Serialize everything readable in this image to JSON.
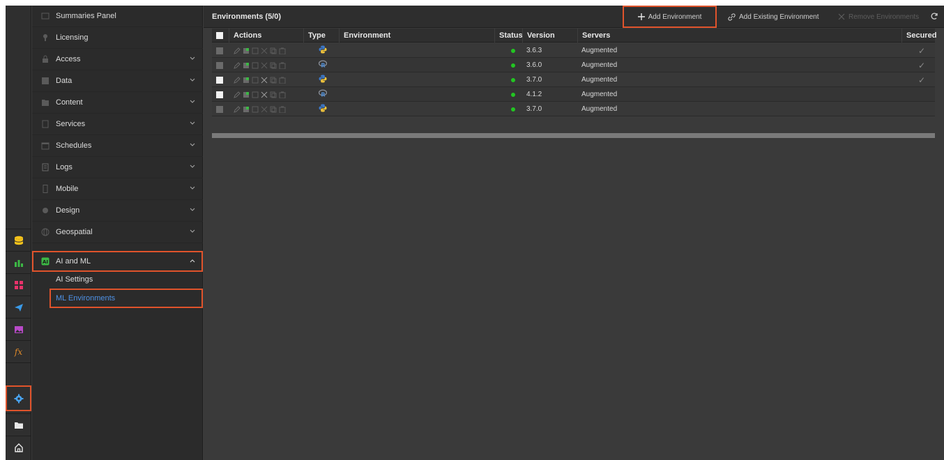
{
  "rail": {
    "icons": [
      "database-icon",
      "bar-chart-icon",
      "dashboard-grid-icon",
      "send-icon",
      "image-icon",
      "function-icon",
      "gear-icon",
      "folder-icon",
      "home-icon"
    ]
  },
  "nav": {
    "items": [
      {
        "label": "Summaries Panel",
        "icon": "summaries-icon",
        "expandable": false
      },
      {
        "label": "Licensing",
        "icon": "license-icon",
        "expandable": false
      },
      {
        "label": "Access",
        "icon": "lock-icon",
        "expandable": true
      },
      {
        "label": "Data",
        "icon": "database-icon",
        "expandable": true
      },
      {
        "label": "Content",
        "icon": "folder-icon",
        "expandable": true
      },
      {
        "label": "Services",
        "icon": "services-icon",
        "expandable": true
      },
      {
        "label": "Schedules",
        "icon": "calendar-icon",
        "expandable": true
      },
      {
        "label": "Logs",
        "icon": "log-icon",
        "expandable": true
      },
      {
        "label": "Mobile",
        "icon": "mobile-icon",
        "expandable": true
      },
      {
        "label": "Design",
        "icon": "design-icon",
        "expandable": true
      },
      {
        "label": "Geospatial",
        "icon": "globe-icon",
        "expandable": true
      },
      {
        "label": "AI and ML",
        "icon": "ai-icon",
        "expandable": true
      }
    ],
    "sub_items": [
      {
        "label": "AI Settings"
      },
      {
        "label": "ML Environments"
      }
    ]
  },
  "toolbar": {
    "title": "Environments (5/0)",
    "add_env": "Add Environment",
    "add_existing": "Add Existing Environment",
    "remove": "Remove Environments"
  },
  "table": {
    "headers": {
      "actions": "Actions",
      "type": "Type",
      "environment": "Environment",
      "status": "Status",
      "version": "Version",
      "servers": "Servers",
      "secured": "Secured"
    },
    "rows": [
      {
        "type": "python",
        "version": "3.6.3",
        "server": "Augmented",
        "secured": true,
        "checkbox": "gray"
      },
      {
        "type": "r",
        "version": "3.6.0",
        "server": "Augmented",
        "secured": true,
        "checkbox": "gray"
      },
      {
        "type": "python",
        "version": "3.7.0",
        "server": "Augmented",
        "secured": true,
        "checkbox": "white"
      },
      {
        "type": "r",
        "version": "4.1.2",
        "server": "Augmented",
        "secured": false,
        "checkbox": "white"
      },
      {
        "type": "python",
        "version": "3.7.0",
        "server": "Augmented",
        "secured": false,
        "checkbox": "gray"
      }
    ]
  },
  "colors": {
    "highlight": "#e0532b",
    "selected_link": "#4f92e6",
    "status_ok": "#22c522",
    "python_blue": "#3c78c8",
    "python_yellow": "#f0c43c",
    "r_blue": "#4f8fd8"
  }
}
